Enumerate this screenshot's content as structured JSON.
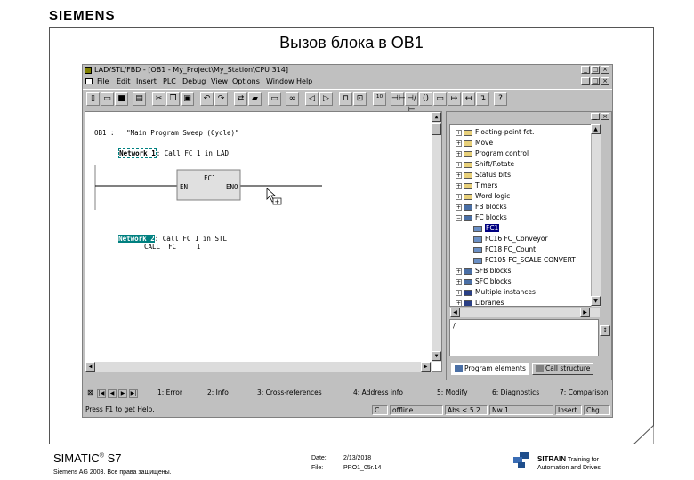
{
  "brand": "SIEMENS",
  "slide_title": "Вызов блока в OB1",
  "window": {
    "title": "LAD/STL/FBD  - [OB1  - My_Project\\My_Station\\CPU 314]",
    "menu": [
      "File",
      "Edit",
      "Insert",
      "PLC",
      "Debug",
      "View",
      "Options",
      "Window",
      "Help"
    ],
    "controls": [
      "_",
      "□",
      "×"
    ]
  },
  "editor": {
    "header": "OB1 :   \"Main Program Sweep (Cycle)\"",
    "network1_label": "Network 1",
    "network1_text": ": Call FC 1 in LAD",
    "block_name": "FC1",
    "pin_en": "EN",
    "pin_eno": "ENO",
    "network2_label": "Network 2",
    "network2_text": ": Call FC 1 in STL",
    "stl_line": "CALL  FC     1"
  },
  "catalog": {
    "items": [
      {
        "pm": "+",
        "label": "Floating-point fct."
      },
      {
        "pm": "+",
        "label": "Move"
      },
      {
        "pm": "+",
        "label": "Program control"
      },
      {
        "pm": "+",
        "label": "Shift/Rotate"
      },
      {
        "pm": "+",
        "label": "Status bits"
      },
      {
        "pm": "+",
        "label": "Timers"
      },
      {
        "pm": "+",
        "label": "Word logic"
      },
      {
        "pm": "+",
        "label": "FB blocks"
      },
      {
        "pm": "−",
        "label": "FC blocks"
      },
      {
        "pm": "",
        "label": "FC1"
      },
      {
        "pm": "",
        "label": "FC16   FC_Conveyor"
      },
      {
        "pm": "",
        "label": "FC18   FC_Count"
      },
      {
        "pm": "",
        "label": "FC105   FC_SCALE   CONVERT"
      },
      {
        "pm": "+",
        "label": "SFB blocks"
      },
      {
        "pm": "+",
        "label": "SFC blocks"
      },
      {
        "pm": "+",
        "label": "Multiple instances"
      },
      {
        "pm": "+",
        "label": "Libraries"
      }
    ],
    "info_text": "/",
    "tab_program": "Program elements",
    "tab_call": "Call structure"
  },
  "tabs": [
    "1: Error",
    "2: Info",
    "3: Cross-references",
    "4: Address info",
    "5: Modify",
    "6: Diagnostics",
    "7: Comparison"
  ],
  "status": {
    "hint": "Press F1 to get Help.",
    "c": "C",
    "mode": "offline",
    "abs": "Abs < 5.2",
    "nw": "Nw 1",
    "ins": "Insert",
    "chg": "Chg"
  },
  "footer": {
    "product": "SIMATIC",
    "reg": "®",
    "version": "S7",
    "copyright": "Siemens AG 2003. Все права защищены.",
    "date_label": "Date:",
    "date_value": "2/13/2018",
    "file_label": "File:",
    "file_value": "PRO1_05r.14",
    "sitrain_name": "SITRAIN",
    "sitrain_line1": "Training for",
    "sitrain_line2": "Automation and Drives"
  },
  "colors": {
    "window_gray": "#c0c0c0",
    "highlight_teal": "#008080",
    "selection_blue": "#000080"
  }
}
